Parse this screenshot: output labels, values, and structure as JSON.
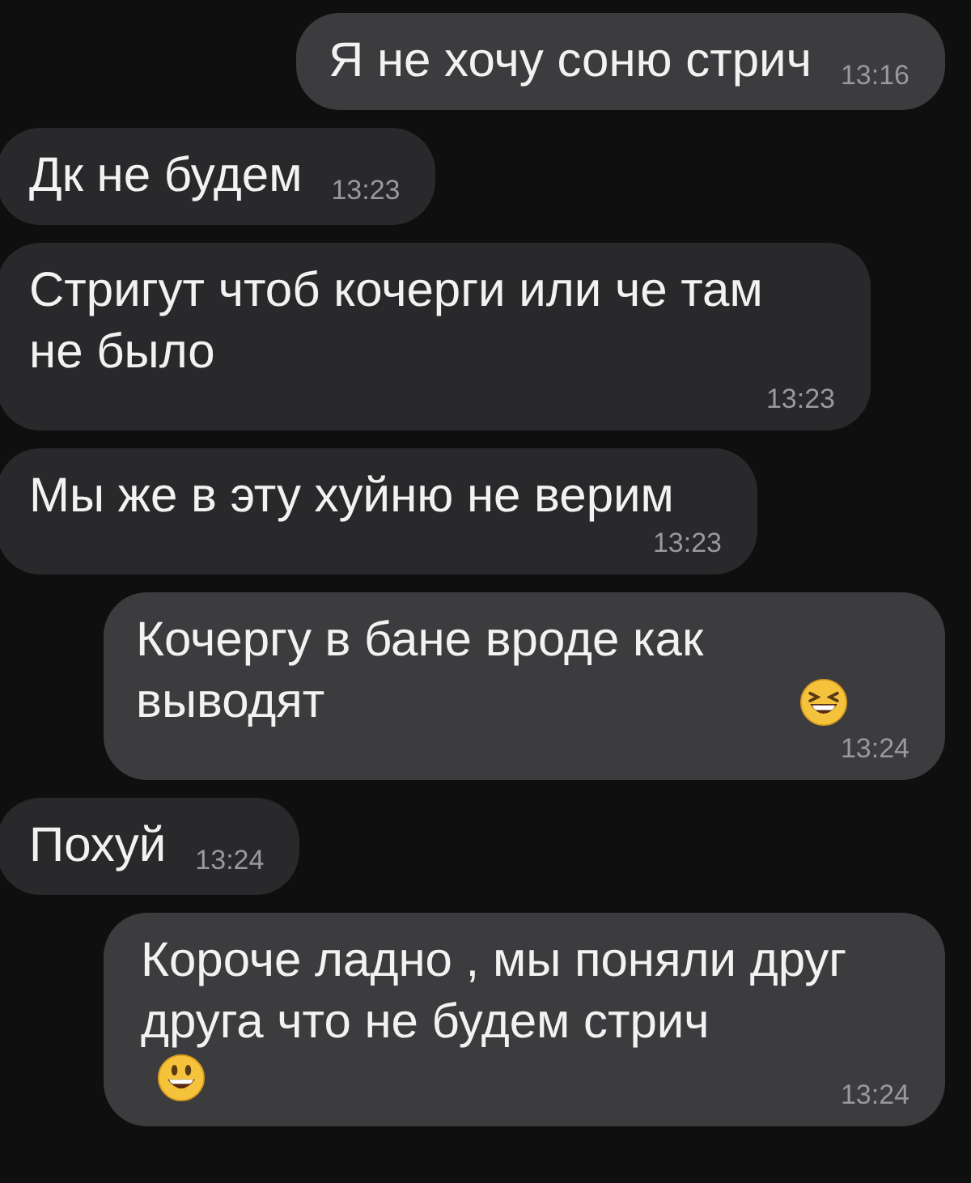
{
  "messages": [
    {
      "outgoing": true,
      "kind": "plain",
      "text": "Я не хочу соню стрич",
      "time": "13:16"
    },
    {
      "outgoing": false,
      "kind": "plain",
      "text": "Дк не будем",
      "time": "13:23"
    },
    {
      "outgoing": false,
      "kind": "plain",
      "text": "Стригут чтоб кочерги или че там не было",
      "time": "13:23"
    },
    {
      "outgoing": false,
      "kind": "plain",
      "text": "Мы же в эту хуйню не верим",
      "time": "13:23"
    },
    {
      "outgoing": true,
      "kind": "laughing",
      "text": "Кочергу в бане вроде как выводят",
      "time": "13:24"
    },
    {
      "outgoing": false,
      "kind": "plain",
      "text": "Похуй",
      "time": "13:24"
    },
    {
      "outgoing": true,
      "kind": "smiling",
      "text": "Короче ладно , мы поняли друг друга что не будем стрич",
      "time": "13:24"
    }
  ]
}
